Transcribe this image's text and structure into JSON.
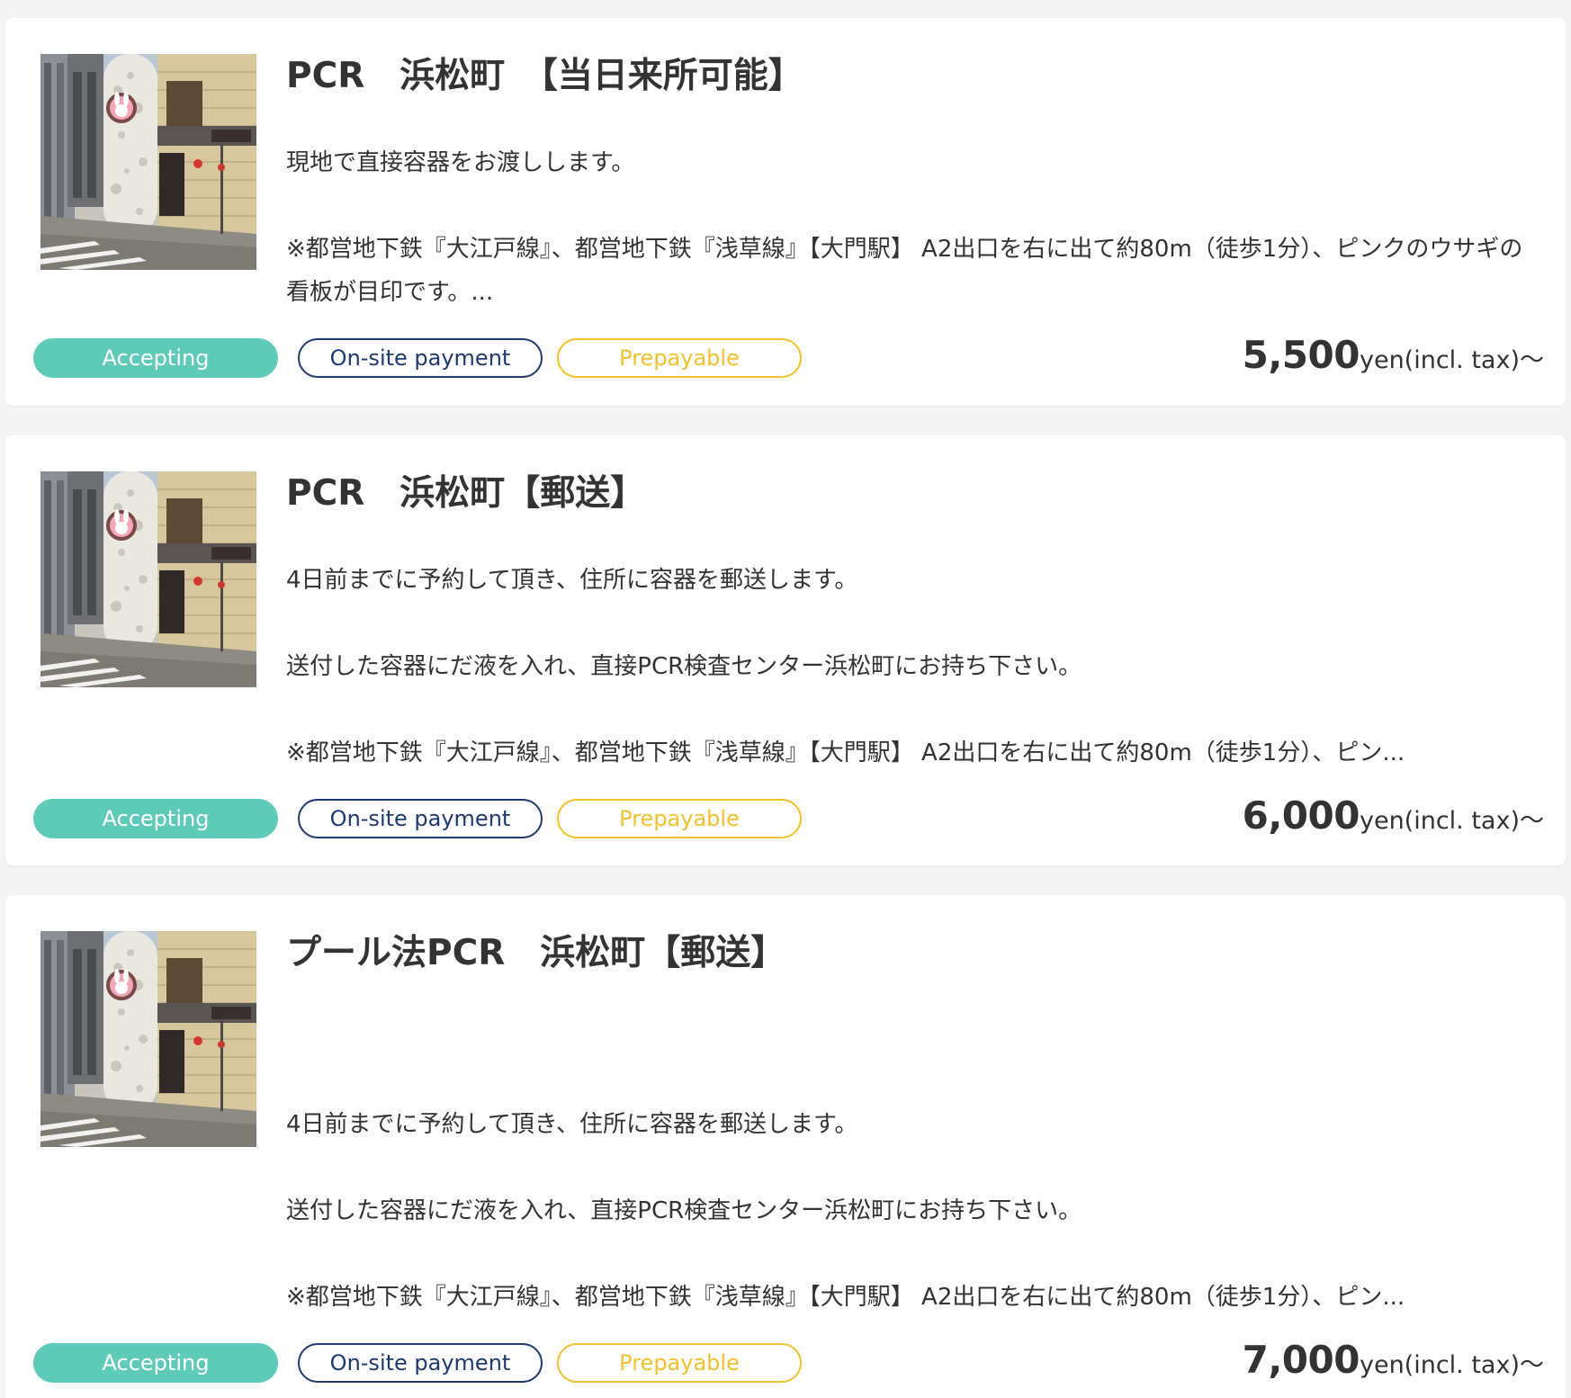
{
  "colors": {
    "accepting": "#5ecab9",
    "onsite": "#1e3a6e",
    "prepayable": "#f2c230",
    "text": "#333333"
  },
  "cards": [
    {
      "title": "PCR　浜松町　【当日来所可能】",
      "image": "storefront-photo",
      "description": [
        "現地で直接容器をお渡しします。",
        "※都営地下鉄『大江戸線』、都営地下鉄『浅草線』【大門駅】 A2出口を右に出て約80m（徒歩1分）、ピンクのウサギの看板が目印です。..."
      ],
      "badges": {
        "accepting": "Accepting",
        "onsite": "On-site payment",
        "prepayable": "Prepayable"
      },
      "price": "5,500",
      "price_unit": "yen(incl. tax)〜"
    },
    {
      "title": "PCR　浜松町【郵送】",
      "image": "storefront-photo",
      "description": [
        "4日前までに予約して頂き、住所に容器を郵送します。",
        "送付した容器にだ液を入れ、直接PCR検査センター浜松町にお持ち下さい。",
        "※都営地下鉄『大江戸線』、都営地下鉄『浅草線』【大門駅】 A2出口を右に出て約80m（徒歩1分）、ピン..."
      ],
      "badges": {
        "accepting": "Accepting",
        "onsite": "On-site payment",
        "prepayable": "Prepayable"
      },
      "price": "6,000",
      "price_unit": "yen(incl. tax)〜"
    },
    {
      "title": "プール法PCR　浜松町【郵送】",
      "image": "storefront-photo",
      "description": [
        "4日前までに予約して頂き、住所に容器を郵送します。",
        "送付した容器にだ液を入れ、直接PCR検査センター浜松町にお持ち下さい。",
        "※都営地下鉄『大江戸線』、都営地下鉄『浅草線』【大門駅】 A2出口を右に出て約80m（徒歩1分）、ピン..."
      ],
      "badges": {
        "accepting": "Accepting",
        "onsite": "On-site payment",
        "prepayable": "Prepayable"
      },
      "price": "7,000",
      "price_unit": "yen(incl. tax)〜"
    }
  ]
}
